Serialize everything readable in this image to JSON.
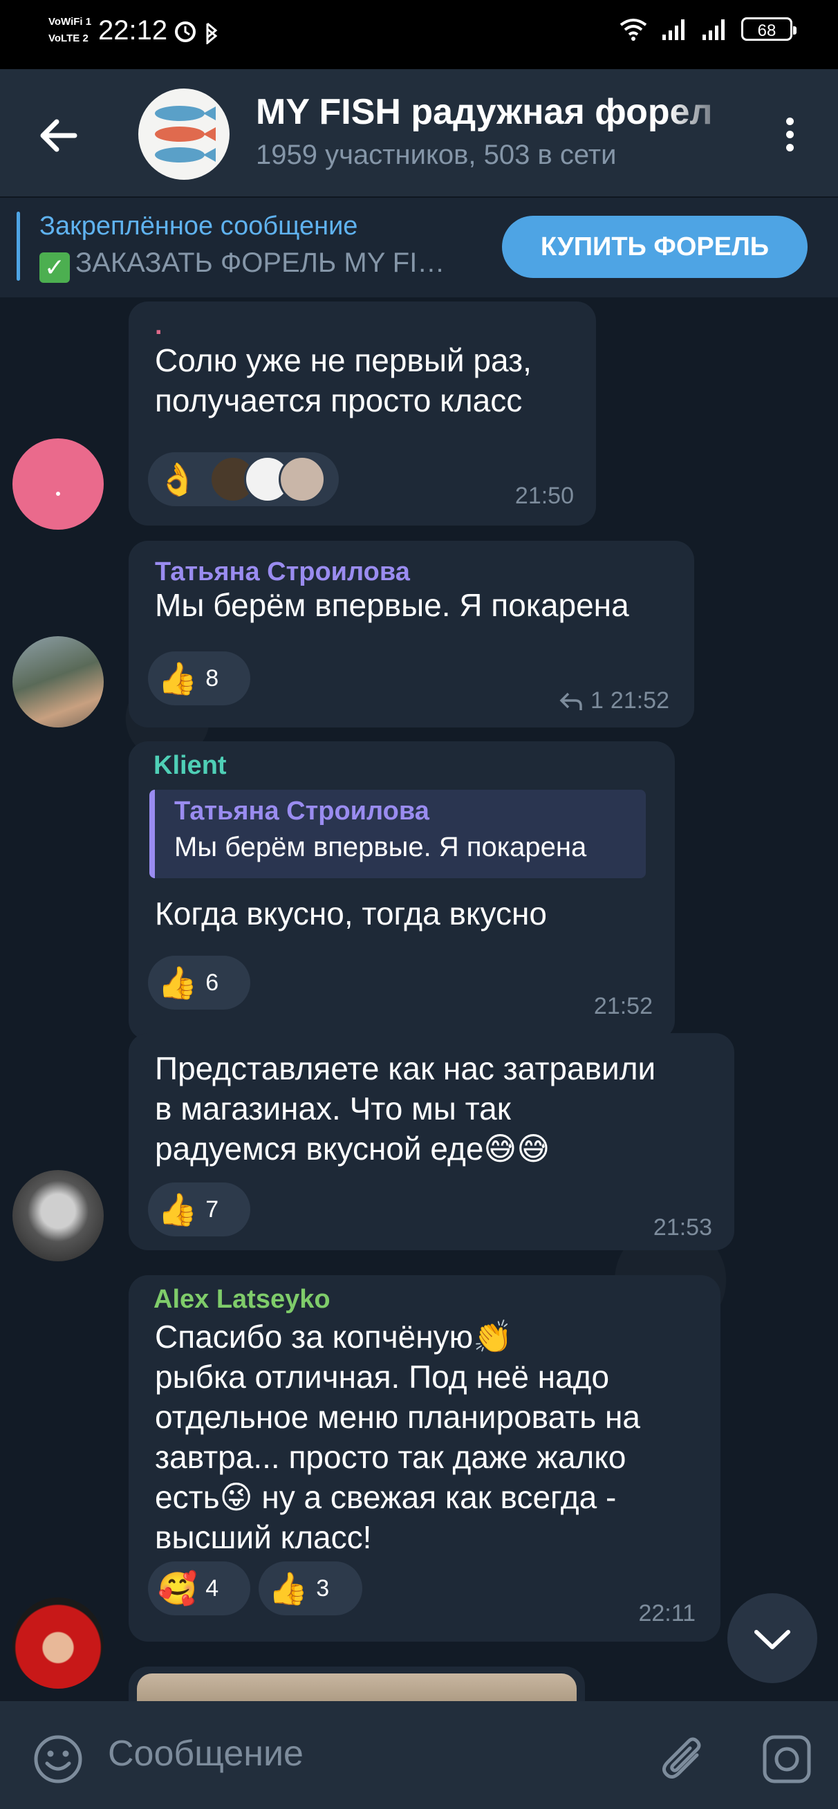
{
  "status_bar": {
    "time": "22:12",
    "net_top": "VoWiFi 1",
    "net_bottom": "VoLTE 2",
    "battery": "68"
  },
  "header": {
    "title": "MY FISH радужная форел",
    "subtitle": "1959 участников, 503 в сети"
  },
  "pinned": {
    "title": "Закреплённое сообщение",
    "text": "ЗАКАЗАТЬ ФОРЕЛЬ MY FI…",
    "check_icon": "check-mark-icon",
    "button_label": "КУПИТЬ ФОРЕЛЬ"
  },
  "messages": [
    {
      "sender": ".",
      "text_lines": [
        "Солю уже не первый раз,",
        "получается просто класс"
      ],
      "reaction_emoji": "👌",
      "time": "21:50"
    },
    {
      "sender": "Татьяна Строилова",
      "text_lines": [
        "Мы берём впервые. Я покарена"
      ],
      "reaction_emoji": "👍",
      "reaction_count": "8",
      "reply_count": "1",
      "time": "21:52"
    },
    {
      "sender": "Klient",
      "reply_to_sender": "Татьяна Строилова",
      "reply_to_text": "Мы берём впервые. Я покарена",
      "text_lines": [
        "Когда вкусно, тогда вкусно"
      ],
      "reaction_emoji": "👍",
      "reaction_count": "6",
      "time": "21:52"
    },
    {
      "text_lines": [
        "Представляете как нас затравили",
        "в магазинах. Что мы так",
        "радуемся вкусной еде😅😅"
      ],
      "reaction_emoji": "👍",
      "reaction_count": "7",
      "time": "21:53"
    },
    {
      "sender": "Alex Latseyko",
      "text_lines": [
        "Спасибо за копчёную👏",
        "рыбка отличная. Под неё надо",
        "отдельное меню планировать на",
        "завтра... просто так даже жалко",
        "есть😜 ну а свежая как всегда -",
        "высший класс!"
      ],
      "reactions": [
        {
          "emoji": "🥰",
          "count": "4"
        },
        {
          "emoji": "👍",
          "count": "3"
        }
      ],
      "time": "22:11"
    }
  ],
  "input": {
    "placeholder": "Сообщение"
  },
  "colors": {
    "accent": "#4ea4e4",
    "header_bg": "#222e3c",
    "chat_bg": "#121b26",
    "bubble_bg": "#1e2937",
    "sender_purple": "#9a8cf0",
    "sender_teal": "#4fcfb6",
    "sender_green": "#7fcc6a"
  }
}
